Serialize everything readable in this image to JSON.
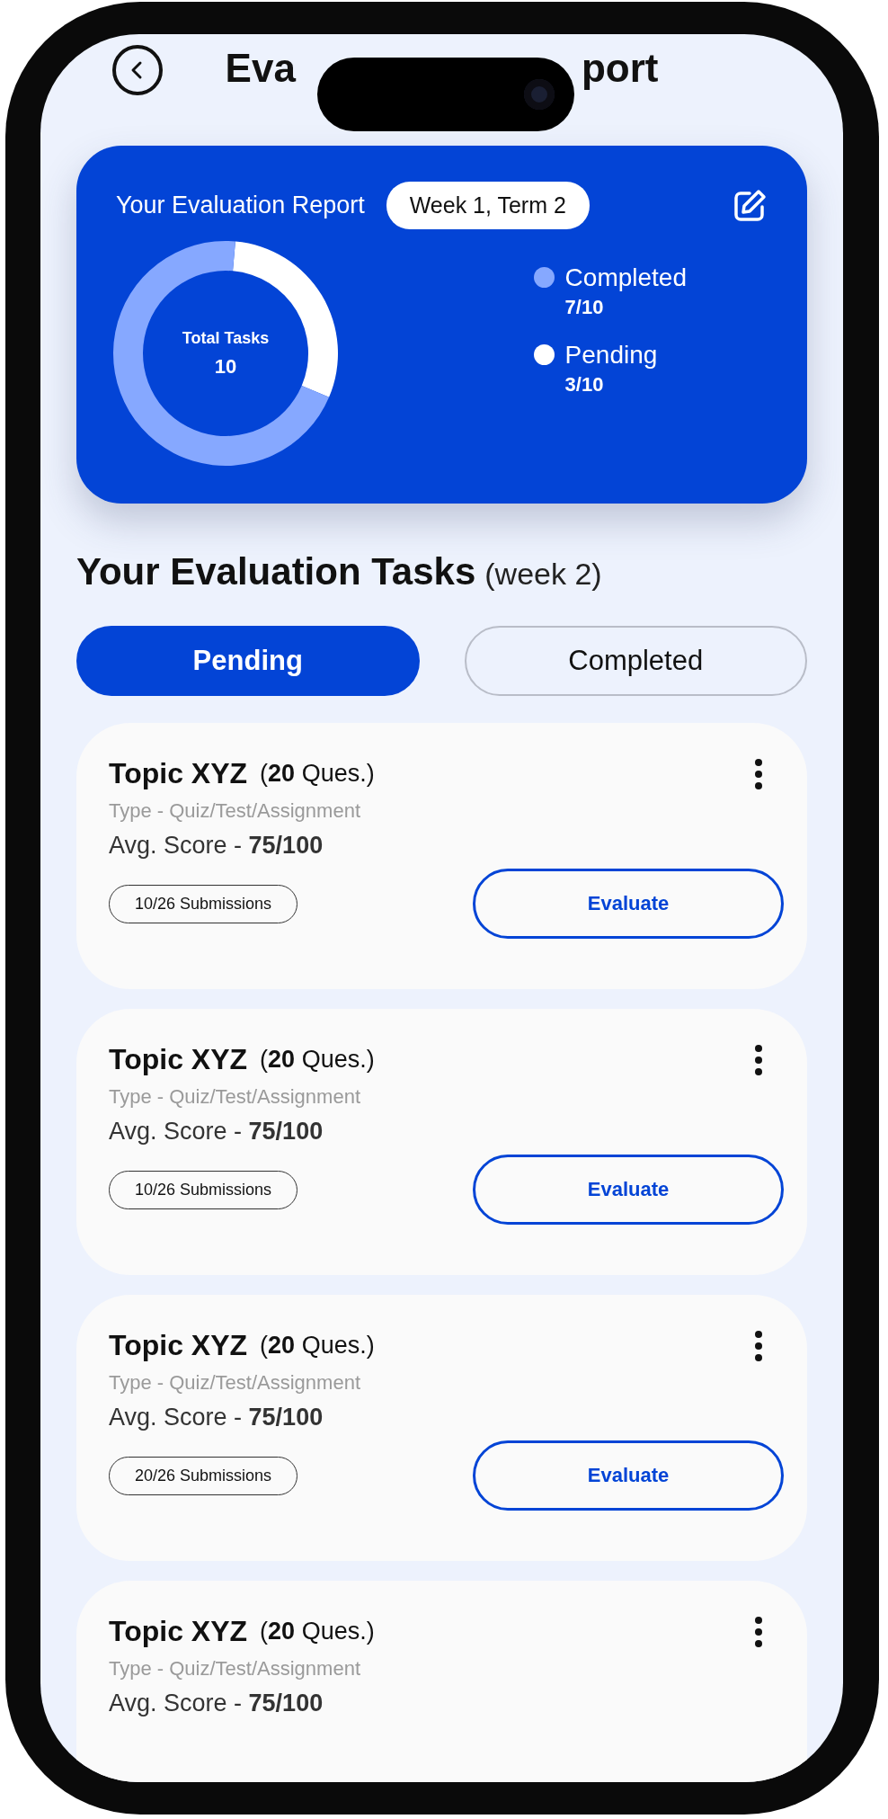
{
  "header": {
    "title_parts": [
      "Eva",
      "port"
    ]
  },
  "report": {
    "title": "Your Evaluation Report",
    "period": "Week 1, Term 2",
    "center_label": "Total Tasks",
    "center_value": "10",
    "legend": [
      {
        "value": "7/10",
        "color": "#86a8ff"
      },
      {
        "value": "3/10",
        "color": "#ffffff"
      }
    ],
    "chart_data": {
      "type": "donut",
      "categories": [
        "Completed",
        "Pending"
      ],
      "series": [
        {
          "values": [
            70,
            30
          ]
        }
      ]
    }
  },
  "section": {
    "title": "Your Evaluation Tasks",
    "note": "(week 2)"
  },
  "tabs": [
    {
      "label": "Pending",
      "selected": true
    },
    {
      "label": "Completed",
      "selected": false
    }
  ],
  "tasks": [
    {
      "title": "Topic XYZ",
      "count": "(**20** Ques.)",
      "type": "Type - Quiz/Test/Assignment",
      "score": "Avg. Score - **75/100**",
      "submissions": "10/26 Submissions",
      "action": "Evaluate"
    },
    {
      "title": "Topic XYZ",
      "count": "(**20** Ques.)",
      "type": "Type - Quiz/Test/Assignment",
      "score": "Avg. Score - **75/100**",
      "submissions": "10/26 Submissions",
      "action": "Evaluate"
    },
    {
      "title": "Topic XYZ",
      "count": "(**20** Ques.)",
      "type": "Type - Quiz/Test/Assignment",
      "score": "Avg. Score - **75/100**",
      "submissions": "20/26 Submissions",
      "action": "Evaluate"
    },
    {
      "title": "Topic XYZ",
      "count": "(**20** Ques.)",
      "type": "Type - Quiz/Test/Assignment",
      "score": "Avg. Score - **75/100**"
    }
  ]
}
